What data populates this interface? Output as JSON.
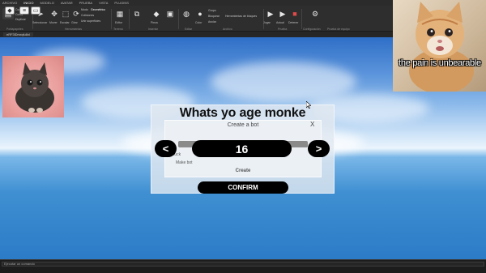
{
  "studio": {
    "menu": "ARCHIVO",
    "tabs": [
      "INICIO",
      "MODELO",
      "AVATAR",
      "PRUEBA",
      "VISTA",
      "PLUGINS"
    ],
    "ribbon": {
      "clipboard": {
        "label": "Portapapeles",
        "options": [
          "Pegar",
          "Copiar",
          "Cortar",
          "Duplicar"
        ]
      },
      "tools": {
        "label": "Herramientas",
        "buttons": [
          "Seleccionar",
          "Mover",
          "Escalar",
          "Girar"
        ]
      },
      "modes": {
        "mode_label": "Modo",
        "mode_value": "Geométrico",
        "collisions": "Colisiones",
        "join": "Unir superficies"
      },
      "terrain": {
        "label": "Terreno",
        "button": "Editor"
      },
      "insert": {
        "label": "Insertar",
        "buttons": [
          "Cuadro de herramientas",
          "Pieza",
          "Interfaz de usuario"
        ]
      },
      "edit": {
        "label": "Editar",
        "buttons": [
          "Material",
          "Color"
        ],
        "group": "Grupo",
        "lock": "Bloquear",
        "anchor": "Anclar"
      },
      "file": {
        "label": "Archivo"
      },
      "test": {
        "label": "Prueba",
        "buttons": [
          "Jugar",
          "Actual",
          "Detener"
        ]
      },
      "settings": {
        "label": "Configuración",
        "button": "Configuración del juego"
      },
      "team": {
        "label": "Prueba de equipo",
        "button": "Prueba de equipo"
      },
      "extra": "Herramientas de bloques"
    },
    "document_tab": "eRF3lDmrqfu8xl",
    "command_placeholder": "Ejecutar un comando"
  },
  "overlay": {
    "meme_caption": "the pain is unbearable"
  },
  "game": {
    "title": "Whats yo age monke",
    "inner_title": "Create a bot",
    "close": "X",
    "label_1": "Set fuck",
    "label_2": "Make bot",
    "create": "Create",
    "prev": "<",
    "next": ">",
    "age": "16",
    "confirm": "CONFIRM"
  },
  "colors": {
    "sky": "#5a93db",
    "pill": "#000000",
    "dialog": "#e1e8f0"
  }
}
